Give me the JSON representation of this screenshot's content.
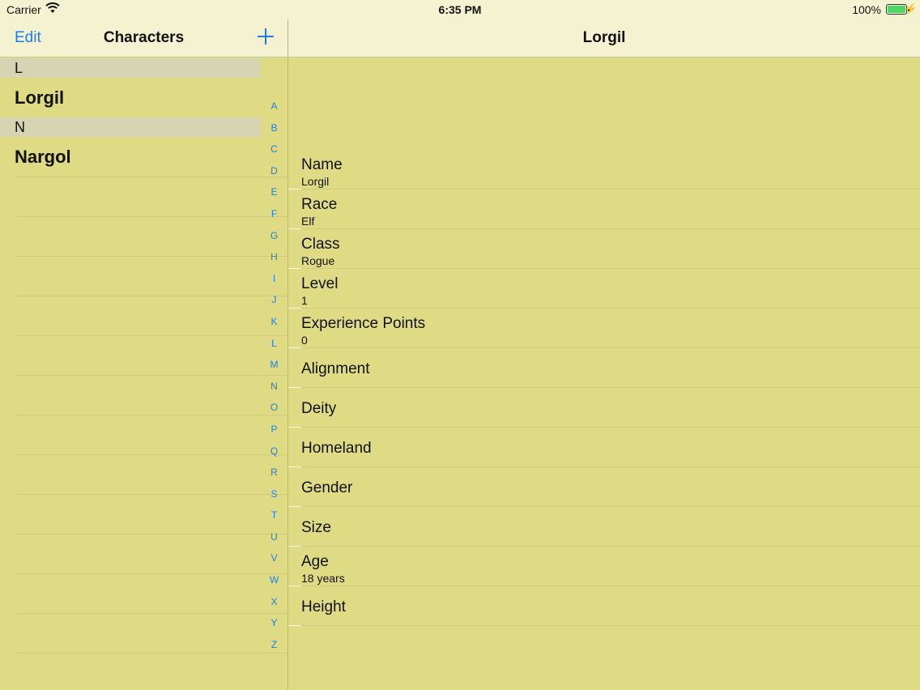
{
  "status_bar": {
    "carrier": "Carrier",
    "time": "6:35 PM",
    "battery": "100%"
  },
  "master": {
    "edit_label": "Edit",
    "title": "Characters",
    "sections": [
      {
        "header": "L",
        "items": [
          "Lorgil"
        ]
      },
      {
        "header": "N",
        "items": [
          "Nargol"
        ]
      }
    ],
    "index": [
      "A",
      "B",
      "C",
      "D",
      "E",
      "F",
      "G",
      "H",
      "I",
      "J",
      "K",
      "L",
      "M",
      "N",
      "O",
      "P",
      "Q",
      "R",
      "S",
      "T",
      "U",
      "V",
      "W",
      "X",
      "Y",
      "Z"
    ]
  },
  "detail": {
    "title": "Lorgil",
    "fields": [
      {
        "label": "Name",
        "value": "Lorgil"
      },
      {
        "label": "Race",
        "value": "Elf"
      },
      {
        "label": "Class",
        "value": "Rogue"
      },
      {
        "label": "Level",
        "value": "1"
      },
      {
        "label": "Experience Points",
        "value": "0"
      },
      {
        "label": "Alignment",
        "value": ""
      },
      {
        "label": "Deity",
        "value": ""
      },
      {
        "label": "Homeland",
        "value": ""
      },
      {
        "label": "Gender",
        "value": ""
      },
      {
        "label": "Size",
        "value": ""
      },
      {
        "label": "Age",
        "value": "18 years"
      },
      {
        "label": "Height",
        "value": ""
      }
    ]
  },
  "colors": {
    "accent": "#1a7ef2",
    "background": "#dedb84",
    "bar": "#f5f2d2",
    "section_header": "#d6d5b3"
  }
}
